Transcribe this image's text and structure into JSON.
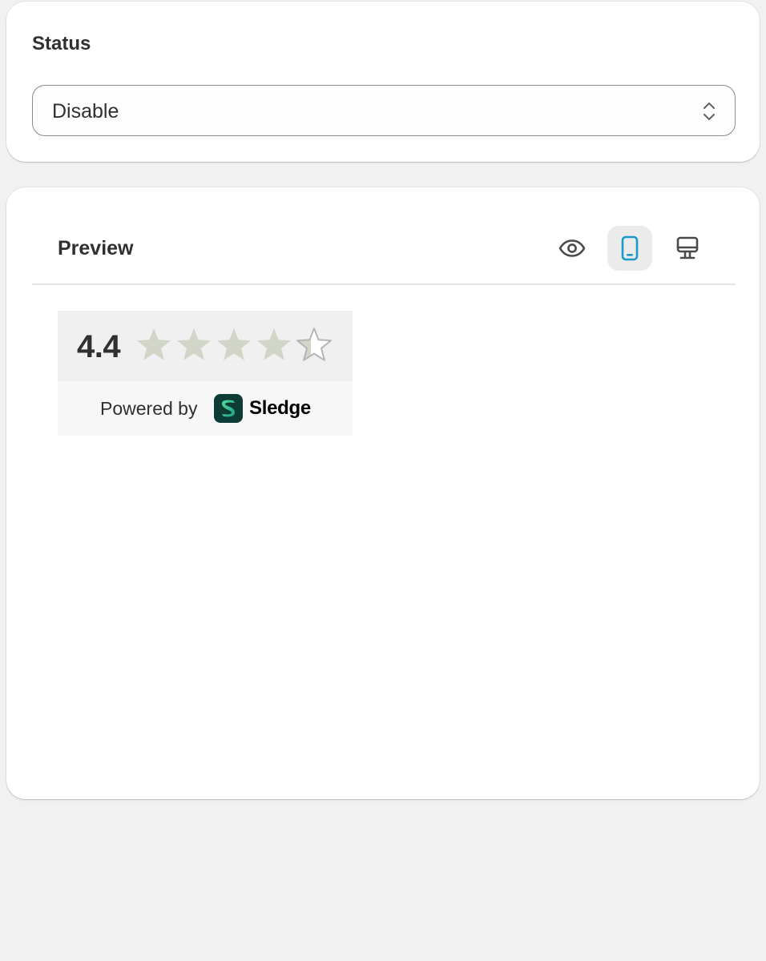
{
  "status": {
    "title": "Status",
    "select": {
      "value": "Disable"
    }
  },
  "preview": {
    "title": "Preview",
    "toolbar": {
      "buttons": [
        {
          "icon": "eye-icon",
          "selected": false
        },
        {
          "icon": "mobile-icon",
          "selected": true
        },
        {
          "icon": "desktop-icon",
          "selected": false
        }
      ]
    },
    "widget": {
      "rating": "4.4",
      "star_rating": {
        "value": 4.4,
        "max": 5
      },
      "powered_by": "Powered by",
      "brand": "Sledge"
    }
  },
  "colors": {
    "star_fill": "#d2d6c8",
    "star_empty_stroke": "#b5b5b5",
    "mobile_icon_active": "#1a9bc7",
    "icon_default": "#4a4a4a",
    "logo_dark": "#0d3b36",
    "logo_light": "#4fdca0"
  }
}
